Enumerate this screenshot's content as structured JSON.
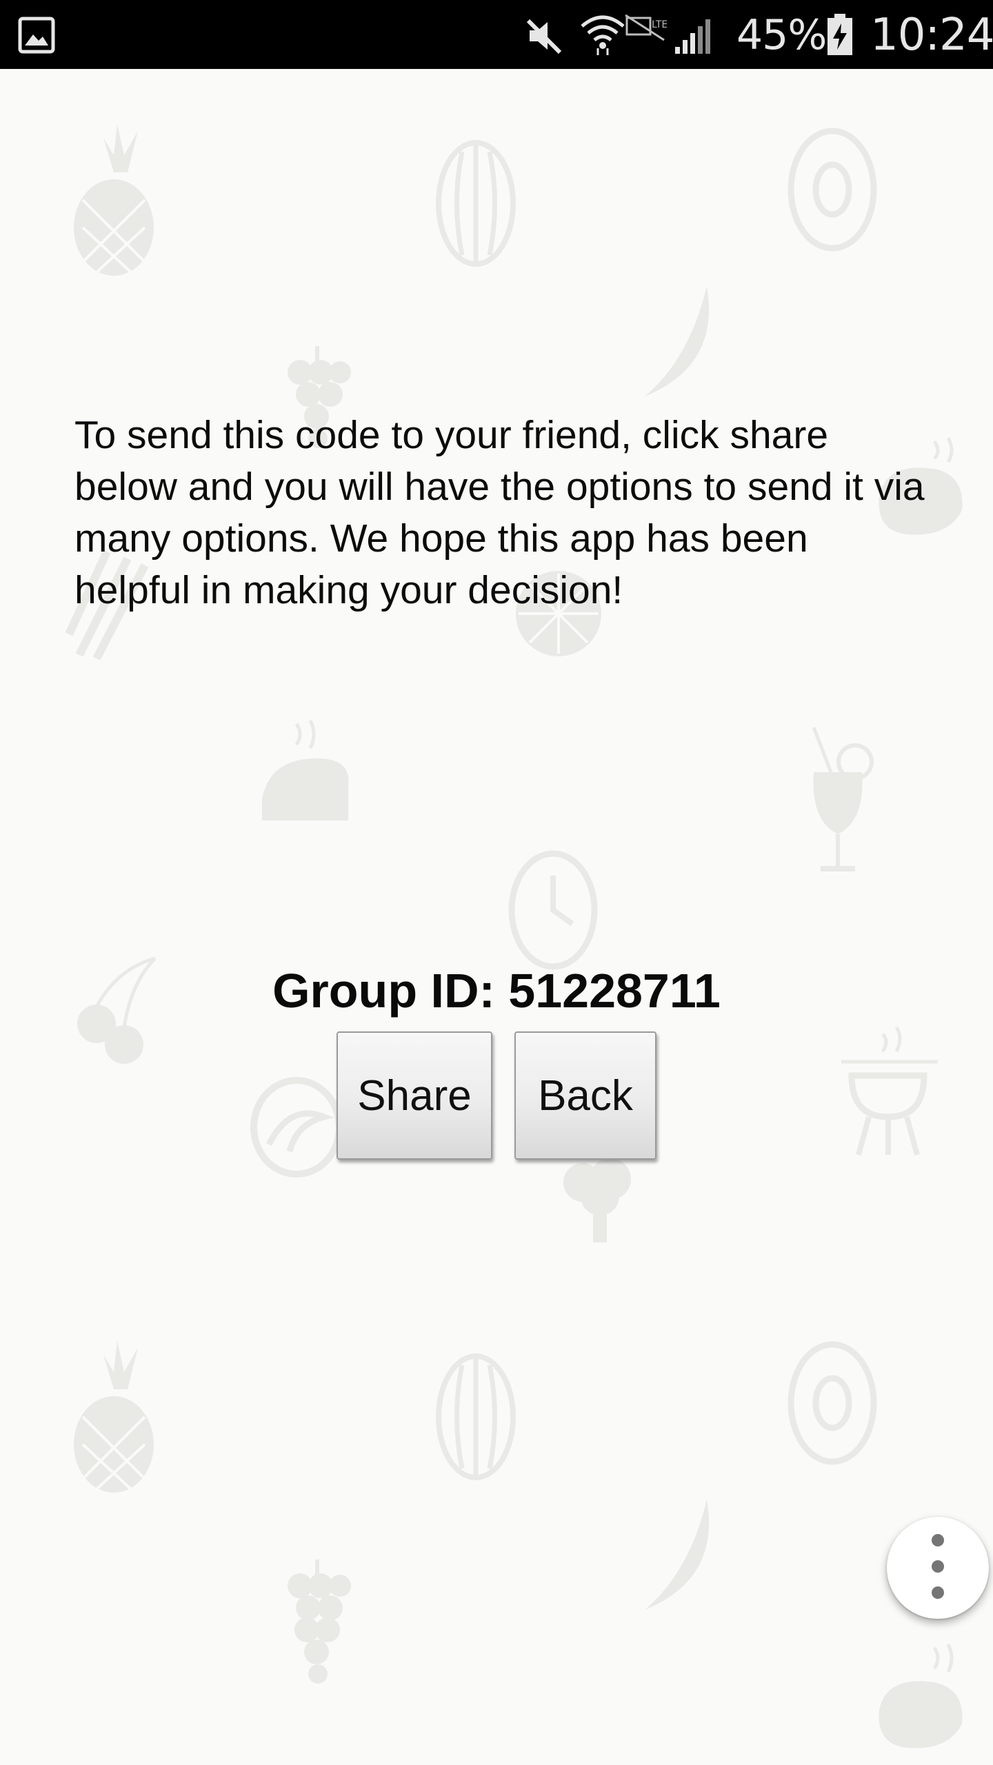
{
  "status_bar": {
    "battery_percent": "45%",
    "time": "10:24",
    "icons": [
      "gallery-icon",
      "mute-icon",
      "wifi-icon",
      "mobile-data-icon",
      "signal-icon",
      "battery-charging-icon"
    ]
  },
  "message": "To send this code to your friend, click share below and you will have the options to send it via many options. We hope this app has been helpful in making your decision!",
  "group": {
    "label": "Group ID: 51228711"
  },
  "buttons": {
    "share": "Share",
    "back": "Back"
  },
  "overflow_menu_icon": "more-vertical-icon",
  "colors": {
    "status_bar_bg": "#000000",
    "page_bg": "#fafaf8",
    "doodle": "#e9e9e6"
  }
}
